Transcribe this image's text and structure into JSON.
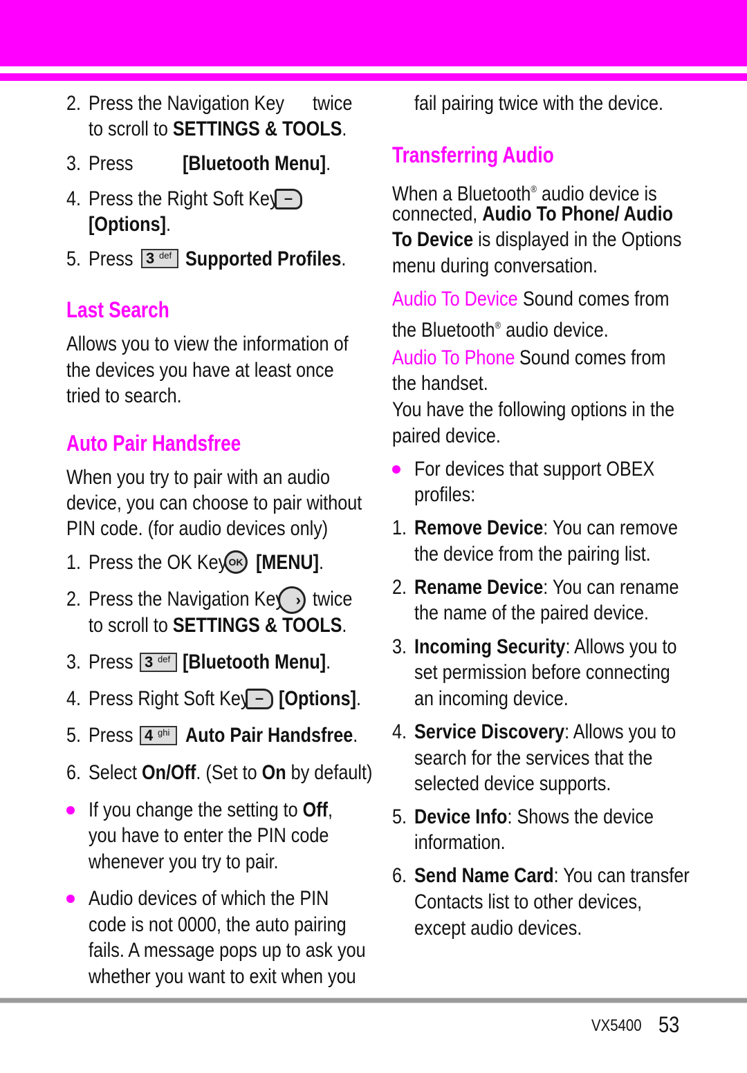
{
  "colors": {
    "accent": "#ff00ff",
    "rule": "#9a9a9a"
  },
  "left_column": {
    "bluetooth_menu_steps_cont": [
      {
        "num": "2.",
        "line1_a": "Press the Navigation Key",
        "line1_b": "twice",
        "line2_a": "to scroll to ",
        "line2_bold": "SETTINGS & TOOLS",
        "line2_c": "."
      },
      {
        "num": "3.",
        "a": "Press",
        "bold": "[Bluetooth Menu]",
        "c": "."
      },
      {
        "num": "4.",
        "a": "Press the Right Soft Key",
        "icon": "right-soft-key-icon",
        "line2_bold": "[Options]",
        "line2_c": "."
      },
      {
        "num": "5.",
        "a": "Press",
        "key_digit": "3",
        "key_letters": "def",
        "bold": "Supported Profiles",
        "c": "."
      }
    ],
    "last_search": {
      "heading": "Last Search",
      "lines": [
        "Allows you to view the information of",
        "the devices you have at least once",
        "tried to search."
      ]
    },
    "auto_pair": {
      "heading": "Auto Pair Handsfree",
      "lines": [
        "When you try to pair with an audio",
        "device, you can choose to pair without",
        "PIN code. (for audio devices only)"
      ],
      "steps": [
        {
          "num": "1.",
          "a": "Press the OK Key",
          "icon_text": "OK",
          "bold": "[MENU]",
          "c": "."
        },
        {
          "num": "2.",
          "a": "Press the Navigation Key",
          "b": "twice",
          "line2_a": "to scroll to ",
          "line2_bold": "SETTINGS & TOOLS",
          "line2_c": "."
        },
        {
          "num": "3.",
          "a": "Press",
          "key_digit": "3",
          "key_letters": "def",
          "bold": "[Bluetooth Menu]",
          "c": "."
        },
        {
          "num": "4.",
          "a": "Press Right Soft Key",
          "bold": "[Options]",
          "c": "."
        },
        {
          "num": "5.",
          "a": "Press",
          "key_digit": "4",
          "key_letters": "ghi",
          "bold": "Auto Pair Handsfree",
          "c": "."
        },
        {
          "num": "6.",
          "a": "Select ",
          "bold1": "On/Off",
          "b": ". (Set to ",
          "bold2": "On",
          "c": " by default)"
        }
      ],
      "bullets": [
        {
          "lines": [
            "If you change the setting to ",
            "you have to enter the PIN code",
            "whenever you try to pair."
          ],
          "bold": "Off",
          "after_bold": ","
        },
        {
          "lines": [
            "Audio devices of which the PIN",
            "code is not 0000, the auto pairing",
            "fails. A message pops up to ask you",
            "whether you want to exit when you"
          ]
        }
      ]
    }
  },
  "right_column": {
    "continued": "fail pairing twice with the device.",
    "transferring_audio": {
      "heading": "Transferring Audio",
      "p1_l1_a": "When a Bluetooth",
      "reg": "®",
      "p1_l1_b": " audio device is",
      "p1_l2_a": "connected, ",
      "p1_l2_bold": "Audio To Phone/ Audio",
      "p1_l3_bold": "To Device",
      "p1_l3_b": " is displayed in the Options",
      "p1_l4": "menu during conversation.",
      "options": [
        {
          "term": "Audio To Device",
          "l1": "Sound comes from",
          "l2_a": "the Bluetooth",
          "l2_b": " audio device."
        },
        {
          "term": "Audio To Phone",
          "l1": "Sound comes from",
          "l2_a": "the handset."
        }
      ],
      "p2": [
        "You have the following options in the",
        "paired device."
      ],
      "bullet": [
        "For devices that support OBEX",
        "profiles:"
      ],
      "items": [
        {
          "num": "1.",
          "term": "Remove Device",
          "l1": ": You can remove",
          "rest": [
            "the device from the pairing list."
          ]
        },
        {
          "num": "2.",
          "term": "Rename Device",
          "l1": ": You can rename",
          "rest": [
            "the name of the paired device."
          ]
        },
        {
          "num": "3.",
          "term": "Incoming Security",
          "l1": ": Allows you to",
          "rest": [
            "set permission before connecting",
            "an incoming device."
          ]
        },
        {
          "num": "4.",
          "term": "Service Discovery",
          "l1": ": Allows you to",
          "rest": [
            "search for the services that the",
            "selected device supports."
          ]
        },
        {
          "num": "5.",
          "term": "Device Info",
          "l1": ": Shows the device",
          "rest": [
            "information."
          ]
        },
        {
          "num": "6.",
          "term": "Send Name Card",
          "l1": ": You can transfer",
          "rest": [
            "Contacts list to other devices,",
            "except audio devices."
          ]
        }
      ]
    }
  },
  "footer": {
    "model": "VX5400",
    "page": "53"
  }
}
